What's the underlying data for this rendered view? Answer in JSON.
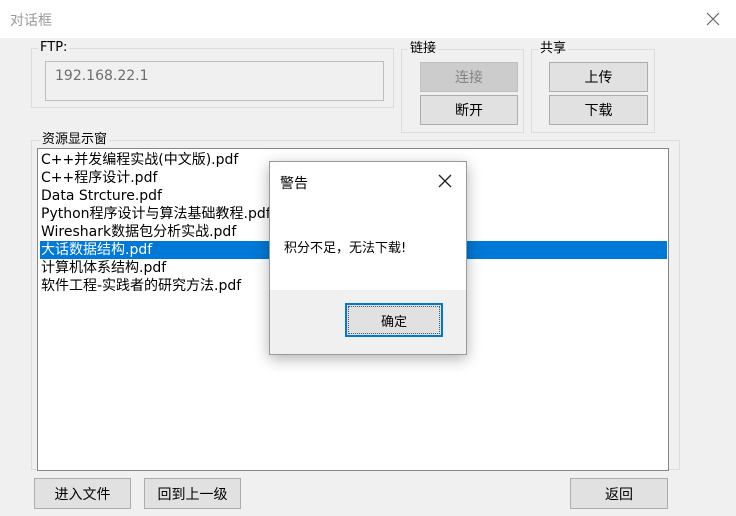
{
  "window": {
    "title": "对话框"
  },
  "ftp": {
    "label": "FTP:",
    "address": "192.168.22.1"
  },
  "connection": {
    "label": "链接",
    "connect": "连接",
    "disconnect": "断开"
  },
  "share": {
    "label": "共享",
    "upload": "上传",
    "download": "下载"
  },
  "resources": {
    "label": "资源显示窗",
    "items": [
      "C++并发编程实战(中文版).pdf",
      "C++程序设计.pdf",
      "Data Strcture.pdf",
      "Python程序设计与算法基础教程.pdf",
      "Wireshark数据包分析实战.pdf",
      "大话数据结构.pdf",
      "计算机体系结构.pdf",
      "软件工程-实践者的研究方法.pdf"
    ],
    "selected_index": 5
  },
  "footer": {
    "enter_file": "进入文件",
    "go_up": "回到上一级",
    "back": "返回"
  },
  "dialog": {
    "title": "警告",
    "message": "积分不足，无法下载!",
    "ok": "确定"
  },
  "colors": {
    "selection": "#0078d7",
    "focus_border": "#0078d7"
  }
}
